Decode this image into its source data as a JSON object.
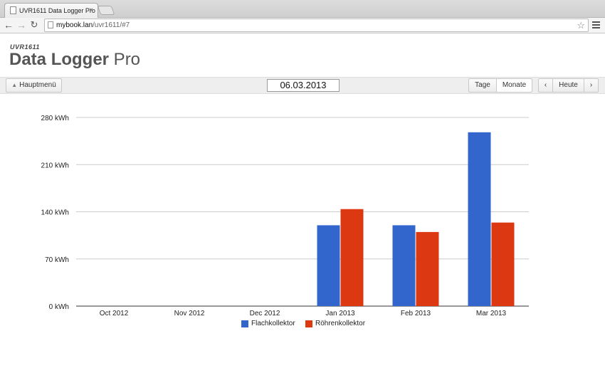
{
  "browser": {
    "tab_title": "UVR1611 Data Logger Pro",
    "tab_close": "×",
    "url_host": "mybook.lan",
    "url_path": "/uvr1611/#7"
  },
  "app": {
    "subtitle": "UVR1611",
    "title_bold": "Data Logger",
    "title_light": " Pro"
  },
  "controls": {
    "menu_label": "Hauptmenü",
    "date": "06.03.2013",
    "days_label": "Tage",
    "months_label": "Monate",
    "prev": "‹",
    "today_label": "Heute",
    "next": "›"
  },
  "colors": {
    "series1": "#3366cc",
    "series2": "#dc3912"
  },
  "chart_data": {
    "type": "bar",
    "categories": [
      "Oct 2012",
      "Nov 2012",
      "Dec 2012",
      "Jan 2013",
      "Feb 2013",
      "Mar 2013"
    ],
    "series": [
      {
        "name": "Flachkollektor",
        "values": [
          0,
          0,
          0,
          120,
          120,
          258
        ]
      },
      {
        "name": "Röhrenkollektor",
        "values": [
          0,
          0,
          0,
          144,
          110,
          124
        ]
      }
    ],
    "yticks": [
      "0 kWh",
      "70 kWh",
      "140 kWh",
      "210 kWh",
      "280 kWh"
    ],
    "ylim": [
      0,
      280
    ],
    "grid": true,
    "legend": "bottom"
  }
}
